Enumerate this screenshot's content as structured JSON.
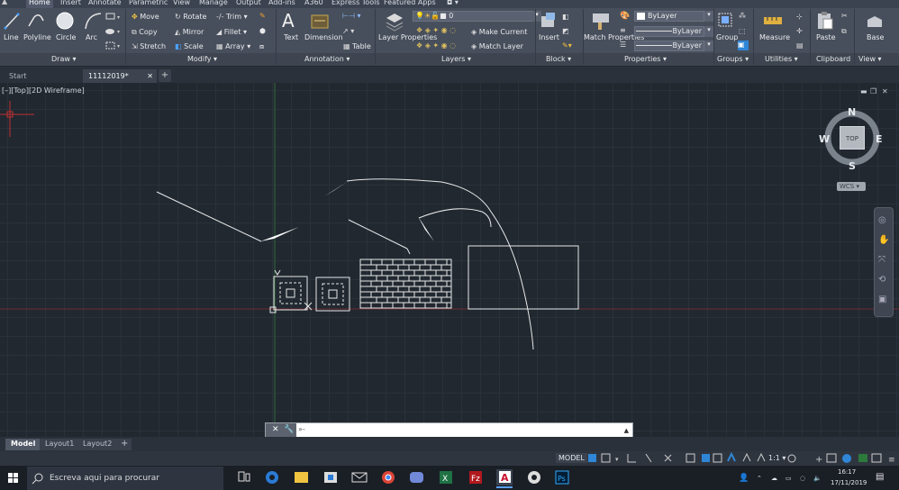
{
  "ribbon_tabs": [
    "Home",
    "Insert",
    "Annotate",
    "Parametric",
    "View",
    "Manage",
    "Output",
    "Add-ins",
    "A360",
    "Express Tools",
    "Featured Apps"
  ],
  "active_tab": "Home",
  "draw_panel": {
    "title": "Draw",
    "line": "Line",
    "polyline": "Polyline",
    "circle": "Circle",
    "arc": "Arc"
  },
  "modify_panel": {
    "title": "Modify",
    "move": "Move",
    "rotate": "Rotate",
    "trim": "Trim",
    "copy": "Copy",
    "mirror": "Mirror",
    "fillet": "Fillet",
    "stretch": "Stretch",
    "scale": "Scale",
    "array": "Array"
  },
  "annotation_panel": {
    "title": "Annotation",
    "text": "Text",
    "dimension": "Dimension",
    "table": "Table"
  },
  "layers_panel": {
    "title": "Layers",
    "layer_properties": "Layer Properties",
    "current_layer": "0",
    "make_current": "Make Current",
    "match_layer": "Match Layer"
  },
  "block_panel": {
    "title": "Block",
    "insert": "Insert"
  },
  "properties_panel": {
    "title": "Properties",
    "match_properties": "Match Properties",
    "color": "ByLayer",
    "linetype": "ByLayer",
    "lineweight": "ByLayer"
  },
  "groups_panel": {
    "title": "Groups",
    "group": "Group"
  },
  "utilities_panel": {
    "title": "Utilities",
    "measure": "Measure"
  },
  "clipboard_panel": {
    "title": "Clipboard",
    "paste": "Paste"
  },
  "view_panel": {
    "title": "View",
    "base": "Base"
  },
  "file_tabs": [
    "Start",
    "11112019*"
  ],
  "viewport_label": "[–][Top][2D Wireframe]",
  "viewcube": {
    "n": "N",
    "s": "S",
    "e": "E",
    "w": "W",
    "top": "TOP",
    "wcs": "WCS"
  },
  "command_line": {
    "prompt": "»- ",
    "value": ""
  },
  "layout_tabs": [
    "Model",
    "Layout1",
    "Layout2"
  ],
  "status": {
    "model": "MODEL",
    "scale": "1:1"
  },
  "taskbar": {
    "search_placeholder": "Escreva aqui para procurar",
    "time": "16:17",
    "date": "17/11/2019"
  },
  "colors": {
    "canvas": "#212830",
    "ribbon": "#474f5c",
    "accent": "#2f86d6"
  }
}
